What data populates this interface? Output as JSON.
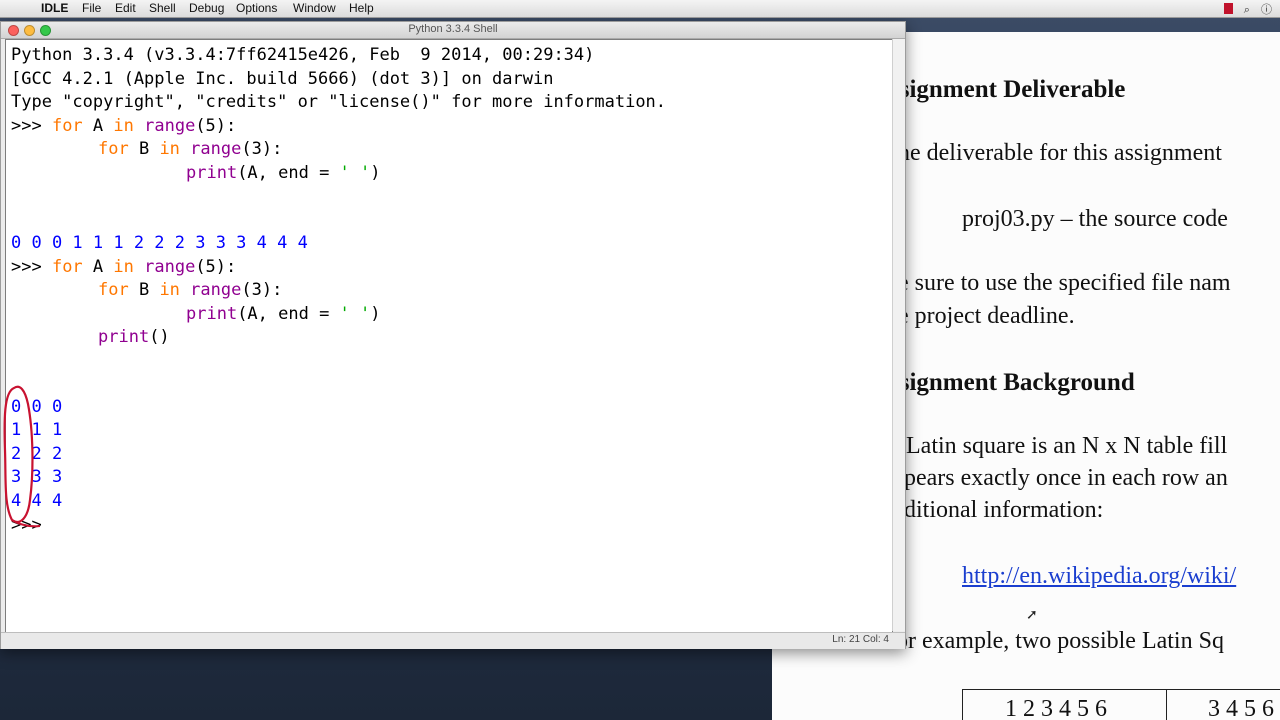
{
  "menubar": {
    "apple": "",
    "items": [
      "IDLE",
      "File",
      "Edit",
      "Shell",
      "Debug",
      "Options",
      "Window",
      "Help"
    ],
    "tray": {
      "spotlight": "⌕",
      "info": "ⓘ"
    }
  },
  "idle_window": {
    "title": "Python 3.3.4 Shell",
    "status": "Ln: 21 Col: 4",
    "lines": {
      "l1": "Python 3.3.4 (v3.3.4:7ff62415e426, Feb  9 2014, 00:29:34)",
      "l2": "[GCC 4.2.1 (Apple Inc. build 5666) (dot 3)] on darwin",
      "l3": "Type \"copyright\", \"credits\" or \"license()\" for more information.",
      "prompt": ">>> ",
      "for_kw": "for",
      "in_kw": "in",
      "range_bi": "range",
      "print_bi": "print",
      "var_A": " A ",
      "var_B": " B ",
      "range5": "(5):",
      "range3": "(3):",
      "print_args_a": "(A, end = ",
      "print_str": "' '",
      "print_args_b": ")",
      "print_empty": "()",
      "out1": "0 0 0 1 1 1 2 2 2 3 3 3 4 4 4",
      "grid_rows": [
        "0 0 0",
        "1 1 1",
        "2 2 2",
        "3 3 3",
        "4 4 4"
      ],
      "final_prompt": ">>>"
    }
  },
  "document": {
    "heading1": "ssignment Deliverable",
    "para1": "ne deliverable for this assignment",
    "file_line": "proj03.py – the source code",
    "para2a": "e sure to use the specified file nam",
    "para2b": "e project deadline.",
    "heading2": "ssignment Background",
    "para3a": "Latin square is an N x N table fill",
    "para3b": "pears exactly once in each row an",
    "para3c": "ditional information:",
    "link": "http://en.wikipedia.org/wiki/",
    "para4": "or example, two possible Latin Sq",
    "table_left": "1 2 3 4 5 6",
    "table_right": "3 4 5 6"
  },
  "colors": {
    "keyword": "#ff7700",
    "builtin": "#900090",
    "string": "#00aa00",
    "output": "#0000ff",
    "annotation": "#c81230",
    "link": "#1a3ecf"
  }
}
